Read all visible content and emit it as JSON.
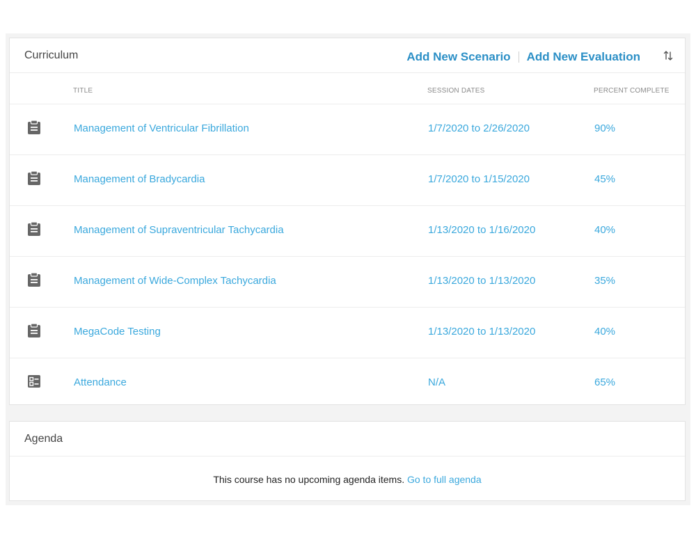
{
  "curriculum": {
    "title": "Curriculum",
    "add_scenario_label": "Add New Scenario",
    "add_evaluation_label": "Add New Evaluation",
    "columns": {
      "title": "TITLE",
      "session_dates": "SESSION DATES",
      "percent_complete": "PERCENT COMPLETE"
    },
    "rows": [
      {
        "icon": "clipboard-icon",
        "title": "Management of Ventricular Fibrillation",
        "dates": "1/7/2020 to 2/26/2020",
        "percent": "90%"
      },
      {
        "icon": "clipboard-icon",
        "title": "Management of Bradycardia",
        "dates": "1/7/2020 to 1/15/2020",
        "percent": "45%"
      },
      {
        "icon": "clipboard-icon",
        "title": "Management of Supraventricular Tachycardia",
        "dates": "1/13/2020 to 1/16/2020",
        "percent": "40%"
      },
      {
        "icon": "clipboard-icon",
        "title": "Management of Wide-Complex Tachycardia",
        "dates": "1/13/2020 to 1/13/2020",
        "percent": "35%"
      },
      {
        "icon": "clipboard-icon",
        "title": "MegaCode Testing",
        "dates": "1/13/2020 to 1/13/2020",
        "percent": "40%"
      },
      {
        "icon": "checklist-icon",
        "title": "Attendance",
        "dates": "N/A",
        "percent": "65%"
      }
    ]
  },
  "agenda": {
    "title": "Agenda",
    "empty_message": "This course has no upcoming agenda items.",
    "full_agenda_link": "Go to full agenda"
  },
  "colors": {
    "link": "#3aa8dd",
    "action": "#2b8fc6",
    "icon": "#666666"
  }
}
